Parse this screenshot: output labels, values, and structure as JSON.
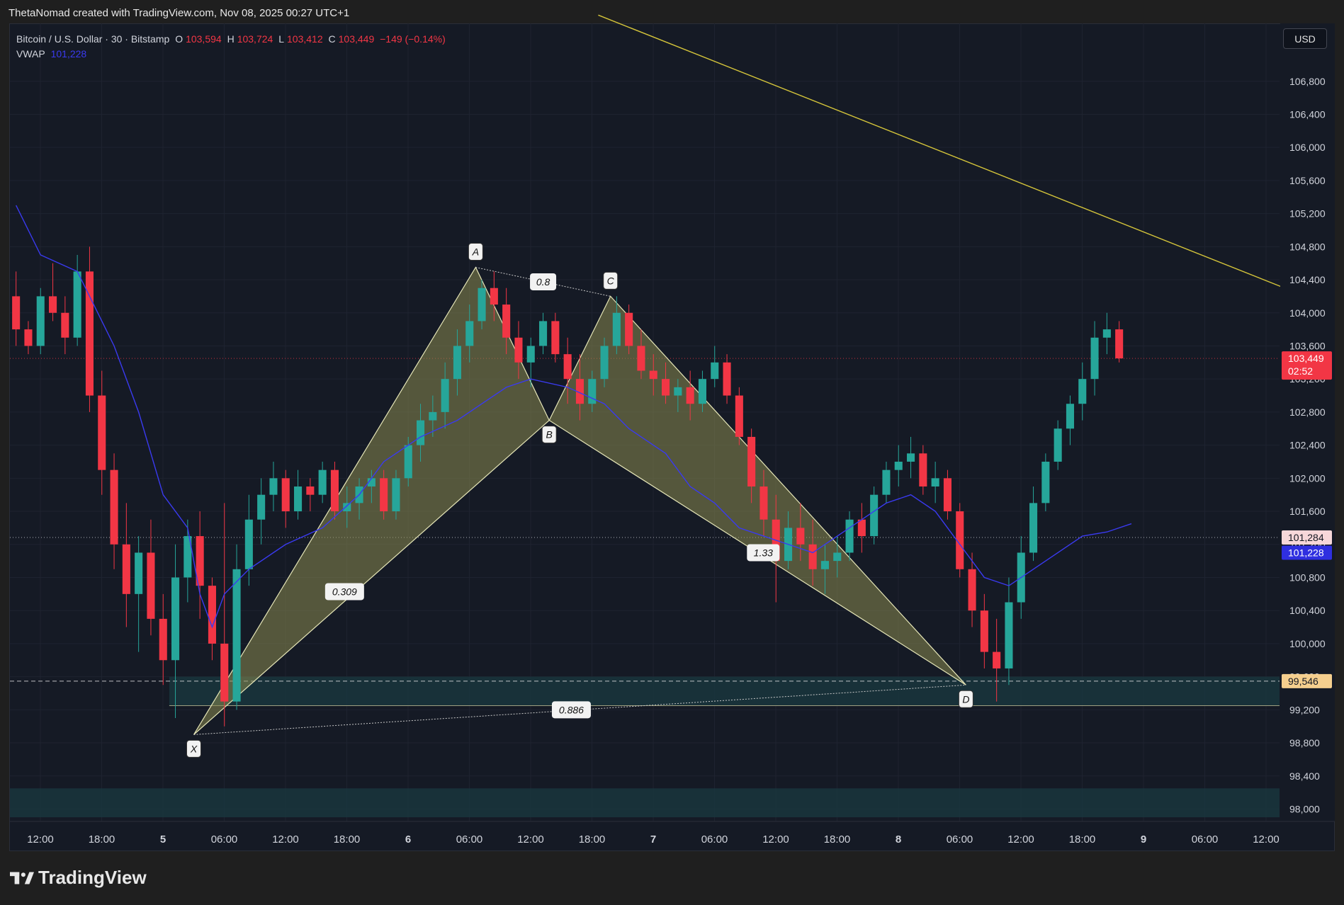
{
  "header": {
    "attribution": "ThetaNomad created with TradingView.com, Nov 08, 2025 00:27 UTC+1"
  },
  "legend": {
    "symbol": "Bitcoin / U.S. Dollar · 30 · Bitstamp",
    "o_label": "O",
    "o_value": "103,594",
    "h_label": "H",
    "h_value": "103,724",
    "l_label": "L",
    "l_value": "103,412",
    "c_label": "C",
    "c_value": "103,449",
    "change": "−149 (−0.14%)",
    "vwap_label": "VWAP",
    "vwap_value": "101,228"
  },
  "currency_button": "USD",
  "footer": {
    "brand": "TradingView"
  },
  "colors": {
    "up": "#26a69a",
    "down": "#f23645",
    "vwap": "#3a3af0",
    "trendline": "#d4c43a",
    "pattern_fill": "#8a8a50",
    "zone": "#1a3a40",
    "price_tag": "#f23645"
  },
  "chart_data": {
    "type": "candlestick",
    "symbol": "BTCUSD",
    "interval": "30",
    "exchange": "Bitstamp",
    "ylim": [
      97850,
      107500
    ],
    "y_ticks": [
      106800,
      106400,
      106000,
      105600,
      105200,
      104800,
      104400,
      104000,
      103600,
      103200,
      102800,
      102400,
      102000,
      101600,
      101200,
      100800,
      100400,
      100000,
      99600,
      99200,
      98800,
      98400,
      98000
    ],
    "y_tick_labels": [
      "106,800",
      "106,400",
      "106,000",
      "105,600",
      "105,200",
      "104,800",
      "104,400",
      "104,000",
      "103,600",
      "103,200",
      "102,800",
      "102,400",
      "102,000",
      "101,600",
      "101,200",
      "100,800",
      "100,400",
      "100,000",
      "99,600",
      "99,200",
      "98,800",
      "98,400",
      "98,000"
    ],
    "x_ticks": [
      "12:00",
      "18:00",
      "5",
      "06:00",
      "12:00",
      "18:00",
      "6",
      "06:00",
      "12:00",
      "18:00",
      "7",
      "06:00",
      "12:00",
      "18:00",
      "8",
      "06:00",
      "12:00",
      "18:00",
      "9",
      "06:00",
      "12:00"
    ],
    "x_tick_bold": [
      false,
      false,
      true,
      false,
      false,
      false,
      true,
      false,
      false,
      false,
      true,
      false,
      false,
      false,
      true,
      false,
      false,
      false,
      true,
      false,
      false
    ],
    "bars_total": 104,
    "ohlc": [
      [
        104200,
        104500,
        103600,
        103800
      ],
      [
        103800,
        103900,
        103500,
        103600
      ],
      [
        103600,
        104300,
        103500,
        104200
      ],
      [
        104200,
        104600,
        103900,
        104000
      ],
      [
        104000,
        104200,
        103500,
        103700
      ],
      [
        103700,
        104700,
        103600,
        104500
      ],
      [
        104500,
        104800,
        102800,
        103000
      ],
      [
        103000,
        103300,
        101800,
        102100
      ],
      [
        102100,
        102300,
        100900,
        101200
      ],
      [
        101200,
        101700,
        100200,
        100600
      ],
      [
        100600,
        101300,
        99900,
        101100
      ],
      [
        101100,
        101500,
        100100,
        100300
      ],
      [
        100300,
        100600,
        99500,
        99800
      ],
      [
        99800,
        101200,
        99100,
        100800
      ],
      [
        100800,
        101500,
        100500,
        101300
      ],
      [
        101300,
        101600,
        100300,
        100700
      ],
      [
        100700,
        100800,
        99800,
        100000
      ],
      [
        100000,
        101700,
        99000,
        99300
      ],
      [
        99300,
        101200,
        99200,
        100900
      ],
      [
        100900,
        101800,
        100700,
        101500
      ],
      [
        101500,
        102000,
        101200,
        101800
      ],
      [
        101800,
        102200,
        101600,
        102000
      ],
      [
        102000,
        102100,
        101400,
        101600
      ],
      [
        101600,
        102100,
        101500,
        101900
      ],
      [
        101900,
        102000,
        101600,
        101800
      ],
      [
        101800,
        102200,
        101700,
        102100
      ],
      [
        102100,
        102200,
        101500,
        101600
      ],
      [
        101600,
        101900,
        101400,
        101700
      ],
      [
        101700,
        102000,
        101500,
        101900
      ],
      [
        101900,
        102100,
        101700,
        102000
      ],
      [
        102000,
        102100,
        101500,
        101600
      ],
      [
        101600,
        102100,
        101500,
        102000
      ],
      [
        102000,
        102500,
        101900,
        102400
      ],
      [
        102400,
        102900,
        102200,
        102700
      ],
      [
        102700,
        103000,
        102500,
        102800
      ],
      [
        102800,
        103400,
        102600,
        103200
      ],
      [
        103200,
        103800,
        103000,
        103600
      ],
      [
        103600,
        104100,
        103400,
        103900
      ],
      [
        103900,
        104400,
        103800,
        104300
      ],
      [
        104300,
        104500,
        103900,
        104100
      ],
      [
        104100,
        104300,
        103500,
        103700
      ],
      [
        103700,
        103900,
        103200,
        103400
      ],
      [
        103400,
        103700,
        103100,
        103600
      ],
      [
        103600,
        104000,
        103500,
        103900
      ],
      [
        103900,
        104000,
        103400,
        103500
      ],
      [
        103500,
        103700,
        102900,
        103200
      ],
      [
        103200,
        103500,
        102700,
        102900
      ],
      [
        102900,
        103300,
        102800,
        103200
      ],
      [
        103200,
        103700,
        103100,
        103600
      ],
      [
        103600,
        104200,
        103500,
        104000
      ],
      [
        104000,
        104100,
        103500,
        103600
      ],
      [
        103600,
        103800,
        103200,
        103300
      ],
      [
        103300,
        103500,
        103000,
        103200
      ],
      [
        103200,
        103400,
        102900,
        103000
      ],
      [
        103000,
        103200,
        102800,
        103100
      ],
      [
        103100,
        103300,
        102700,
        102900
      ],
      [
        102900,
        103300,
        102800,
        103200
      ],
      [
        103200,
        103600,
        103100,
        103400
      ],
      [
        103400,
        103500,
        102900,
        103000
      ],
      [
        103000,
        103100,
        102400,
        102500
      ],
      [
        102500,
        102600,
        101700,
        101900
      ],
      [
        101900,
        102100,
        101300,
        101500
      ],
      [
        101500,
        101800,
        100500,
        101000
      ],
      [
        101000,
        101600,
        100900,
        101400
      ],
      [
        101400,
        101700,
        101000,
        101200
      ],
      [
        101200,
        101500,
        100700,
        100900
      ],
      [
        100900,
        101200,
        100600,
        101000
      ],
      [
        101000,
        101300,
        100800,
        101100
      ],
      [
        101100,
        101600,
        101000,
        101500
      ],
      [
        101500,
        101700,
        101100,
        101300
      ],
      [
        101300,
        101900,
        101200,
        101800
      ],
      [
        101800,
        102200,
        101700,
        102100
      ],
      [
        102100,
        102400,
        101900,
        102200
      ],
      [
        102200,
        102500,
        102000,
        102300
      ],
      [
        102300,
        102400,
        101800,
        101900
      ],
      [
        101900,
        102200,
        101700,
        102000
      ],
      [
        102000,
        102100,
        101500,
        101600
      ],
      [
        101600,
        101700,
        100800,
        100900
      ],
      [
        100900,
        101100,
        100200,
        100400
      ],
      [
        100400,
        100600,
        99700,
        99900
      ],
      [
        99900,
        100300,
        99300,
        99700
      ],
      [
        99700,
        100800,
        99500,
        100500
      ],
      [
        100500,
        101300,
        100300,
        101100
      ],
      [
        101100,
        101900,
        101000,
        101700
      ],
      [
        101700,
        102300,
        101600,
        102200
      ],
      [
        102200,
        102700,
        102100,
        102600
      ],
      [
        102600,
        103000,
        102400,
        102900
      ],
      [
        102900,
        103400,
        102700,
        103200
      ],
      [
        103200,
        103900,
        103000,
        103700
      ],
      [
        103700,
        104000,
        103500,
        103800
      ],
      [
        103800,
        103900,
        103400,
        103449
      ]
    ],
    "vwap": {
      "name": "VWAP",
      "points": [
        [
          0,
          105300
        ],
        [
          2,
          104700
        ],
        [
          5,
          104500
        ],
        [
          8,
          103600
        ],
        [
          10,
          102800
        ],
        [
          12,
          101800
        ],
        [
          14,
          101400
        ],
        [
          15,
          100600
        ],
        [
          16,
          100200
        ],
        [
          17,
          100600
        ],
        [
          19,
          100900
        ],
        [
          22,
          101200
        ],
        [
          25,
          101400
        ],
        [
          28,
          101800
        ],
        [
          30,
          102200
        ],
        [
          33,
          102500
        ],
        [
          36,
          102700
        ],
        [
          38,
          102900
        ],
        [
          40,
          103100
        ],
        [
          42,
          103200
        ],
        [
          45,
          103100
        ],
        [
          48,
          102900
        ],
        [
          50,
          102600
        ],
        [
          53,
          102300
        ],
        [
          55,
          101900
        ],
        [
          57,
          101700
        ],
        [
          59,
          101400
        ],
        [
          61,
          101300
        ],
        [
          63,
          101200
        ],
        [
          65,
          101100
        ],
        [
          67,
          101300
        ],
        [
          69,
          101500
        ],
        [
          71,
          101700
        ],
        [
          73,
          101800
        ],
        [
          75,
          101600
        ],
        [
          77,
          101200
        ],
        [
          79,
          100800
        ],
        [
          81,
          100700
        ],
        [
          83,
          100900
        ],
        [
          85,
          101100
        ],
        [
          87,
          101300
        ],
        [
          89,
          101350
        ],
        [
          91,
          101450
        ]
      ]
    },
    "harmonic_pattern": {
      "points": [
        {
          "label": "X",
          "bar": 15,
          "price": 98900
        },
        {
          "label": "A",
          "bar": 38,
          "price": 104550
        },
        {
          "label": "B",
          "bar": 44,
          "price": 102700
        },
        {
          "label": "C",
          "bar": 49,
          "price": 104200
        },
        {
          "label": "D",
          "bar": 78,
          "price": 99500
        }
      ],
      "ratios": [
        {
          "label": "0.309",
          "between": [
            "X",
            "B"
          ]
        },
        {
          "label": "0.8",
          "between": [
            "A",
            "C"
          ]
        },
        {
          "label": "1.33",
          "between": [
            "B",
            "D"
          ]
        },
        {
          "label": "0.886",
          "between": [
            "X",
            "D"
          ]
        }
      ]
    },
    "trendline": {
      "from": {
        "bar": 48,
        "price": 107600
      },
      "to": {
        "bar": 104,
        "price": 104300
      }
    },
    "zones": [
      {
        "from_price": 99250,
        "to_price": 99600,
        "from_bar": 13
      },
      {
        "from_price": 97900,
        "to_price": 98250,
        "from_bar": 0
      }
    ],
    "horizontal_lines": [
      {
        "price": 103449,
        "style": "dotted",
        "color": "#f23645"
      },
      {
        "price": 101284,
        "style": "dotted",
        "color": "#d1d4dc"
      },
      {
        "price": 99546,
        "style": "dashed",
        "color": "#e8e8e8"
      }
    ],
    "price_tags": [
      {
        "label": "103,449",
        "sub": "02:52",
        "price": 103449,
        "bg": "#f23645",
        "fg": "#ffffff"
      },
      {
        "label": "101,284",
        "price": 101284,
        "bg": "#f7d7d9",
        "fg": "#131722"
      },
      {
        "label": "101,228",
        "price": 101100,
        "bg": "#2f2fe0",
        "fg": "#ffffff"
      },
      {
        "label": "99,546",
        "price": 99546,
        "bg": "#f5cf8e",
        "fg": "#131722"
      }
    ]
  }
}
